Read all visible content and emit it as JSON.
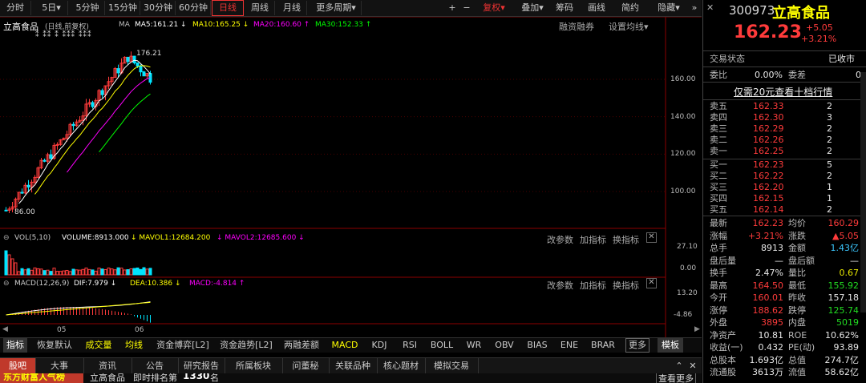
{
  "toolbar": {
    "periods": [
      "分时",
      "5日",
      "5分钟",
      "15分钟",
      "30分钟",
      "60分钟",
      "日线",
      "周线",
      "月线",
      "更多周期"
    ],
    "active": "日线",
    "more_arrow": "▾",
    "right": [
      "+",
      "−",
      "复权",
      "叠加",
      "筹码",
      "画线",
      "简约",
      "隐藏"
    ],
    "right_arrows": "▾"
  },
  "chart": {
    "stock_name": "立高食品",
    "mode": "(日线,前复权)",
    "ma_label": "MA",
    "ma5": "MA5:161.21",
    "ma10": "MA10:165.25",
    "ma20": "MA20:160.60",
    "ma30": "MA30:152.33",
    "rzrq": "融资融券",
    "set_ma": "设置均线",
    "high_label": "176.21",
    "low_label": "86.00",
    "price_axis": [
      "160.00",
      "140.00",
      "120.00",
      "100.00"
    ],
    "markers": "⁑  ⁑⁑ ⁑  ⁑⁑⁑     ⁑⁑⁑"
  },
  "vol": {
    "label": "VOL(5,10)",
    "volume": "VOLUME:8913.000",
    "mavol1": "MAVOL1:12684.200",
    "mavol2": "MAVOL2:12685.600",
    "axis": [
      "27.10",
      "0.00"
    ],
    "btns": [
      "改参数",
      "加指标",
      "换指标"
    ]
  },
  "macd": {
    "label": "MACD(12,26,9)",
    "dif": "DIF:7.979",
    "dea": "DEA:10.386",
    "macd": "MACD:-4.814",
    "axis": [
      "13.20",
      "-4.86"
    ],
    "btns": [
      "改参数",
      "加指标",
      "换指标"
    ],
    "xticks": [
      "05",
      "06"
    ]
  },
  "ind_tabs": [
    "指标",
    "恢复默认",
    "成交量",
    "均线",
    "资金博弈[L2]",
    "资金趋势[L2]",
    "两融差额",
    "MACD",
    "KDJ",
    "RSI",
    "BOLL",
    "WR",
    "OBV",
    "BIAS",
    "ENE",
    "BRAR",
    "更多",
    "模板"
  ],
  "news_tabs": [
    "股吧",
    "大事",
    "资讯",
    "公告",
    "研究报告",
    "所属板块",
    "问董秘",
    "关联品种",
    "核心题材",
    "模拟交易"
  ],
  "ticker": {
    "left": "东方财富人气榜",
    "name": "立高食品",
    "rank_label": "即时排名第",
    "rank": "1330",
    "unit": "名",
    "more": "查看更多"
  },
  "quote": {
    "code": "300973",
    "name": "立高食品",
    "price": "162.23",
    "change": "+5.05",
    "pct": "+3.21%",
    "status_label": "交易状态",
    "status": "已收市",
    "weibi_label": "委比",
    "weibi": "0.00%",
    "weicha_label": "委差",
    "weicha": "0",
    "promo": "仅需20元查看十档行情",
    "asks": [
      {
        "label": "卖五",
        "price": "162.33",
        "vol": "2"
      },
      {
        "label": "卖四",
        "price": "162.30",
        "vol": "3"
      },
      {
        "label": "卖三",
        "price": "162.29",
        "vol": "2"
      },
      {
        "label": "卖二",
        "price": "162.26",
        "vol": "2"
      },
      {
        "label": "卖一",
        "price": "162.25",
        "vol": "2"
      }
    ],
    "bids": [
      {
        "label": "买一",
        "price": "162.23",
        "vol": "5"
      },
      {
        "label": "买二",
        "price": "162.22",
        "vol": "2"
      },
      {
        "label": "买三",
        "price": "162.20",
        "vol": "1"
      },
      {
        "label": "买四",
        "price": "162.15",
        "vol": "1"
      },
      {
        "label": "买五",
        "price": "162.14",
        "vol": "2"
      }
    ],
    "stats": [
      {
        "l1": "最新",
        "v1": "162.23",
        "c1": "red",
        "l2": "均价",
        "v2": "160.29",
        "c2": "red"
      },
      {
        "l1": "涨幅",
        "v1": "+3.21%",
        "c1": "red",
        "l2": "涨跌",
        "v2": "▲5.05",
        "c2": "red"
      },
      {
        "l1": "总手",
        "v1": "8913",
        "c1": "white",
        "l2": "金额",
        "v2": "1.43亿",
        "c2": "cyan"
      },
      {
        "l1": "盘后量",
        "v1": "—",
        "c1": "white",
        "l2": "盘后额",
        "v2": "—",
        "c2": "white"
      },
      {
        "l1": "换手",
        "v1": "2.47%",
        "c1": "white",
        "l2": "量比",
        "v2": "0.67",
        "c2": "yellow"
      },
      {
        "l1": "最高",
        "v1": "164.50",
        "c1": "red",
        "l2": "最低",
        "v2": "155.92",
        "c2": "green"
      },
      {
        "l1": "今开",
        "v1": "160.01",
        "c1": "red",
        "l2": "昨收",
        "v2": "157.18",
        "c2": "white"
      },
      {
        "l1": "涨停",
        "v1": "188.62",
        "c1": "red",
        "l2": "跌停",
        "v2": "125.74",
        "c2": "green"
      },
      {
        "l1": "外盘",
        "v1": "3895",
        "c1": "red",
        "l2": "内盘",
        "v2": "5019",
        "c2": "green"
      },
      {
        "l1": "净资产",
        "v1": "10.81",
        "c1": "white",
        "l2": "ROE",
        "v2": "10.62%",
        "c2": "white"
      },
      {
        "l1": "收益(一)",
        "v1": "0.432",
        "c1": "white",
        "l2": "PE(动)",
        "v2": "93.89",
        "c2": "white"
      },
      {
        "l1": "总股本",
        "v1": "1.693亿",
        "c1": "white",
        "l2": "总值",
        "v2": "274.7亿",
        "c2": "white"
      },
      {
        "l1": "流通股",
        "v1": "3613万",
        "c1": "white",
        "l2": "流值",
        "v2": "58.62亿",
        "c2": "white"
      }
    ]
  },
  "colors": {
    "up": "#ff3b3b",
    "down": "#00e5ff",
    "ma5": "#ffffff",
    "ma10": "#ffff00",
    "ma20": "#ff00ff",
    "ma30": "#00ff00"
  }
}
